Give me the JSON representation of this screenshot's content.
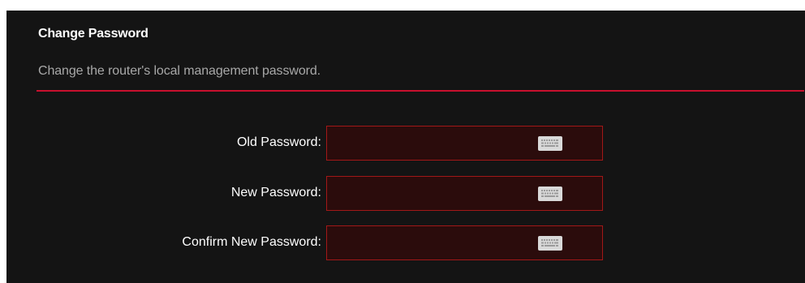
{
  "section": {
    "title": "Change Password",
    "description": "Change the router's local management password."
  },
  "fields": [
    {
      "label": "Old Password:",
      "value": "",
      "icon": "keyboard-icon"
    },
    {
      "label": "New Password:",
      "value": "",
      "icon": "keyboard-icon"
    },
    {
      "label": "Confirm New Password:",
      "value": "",
      "icon": "keyboard-icon"
    }
  ],
  "colors": {
    "panel_background": "#141414",
    "accent_red": "#c8102e",
    "field_background": "#2b0c0c",
    "field_border": "#a11818",
    "title_text": "#ffffff",
    "subtitle_text": "#a8a8a8"
  }
}
